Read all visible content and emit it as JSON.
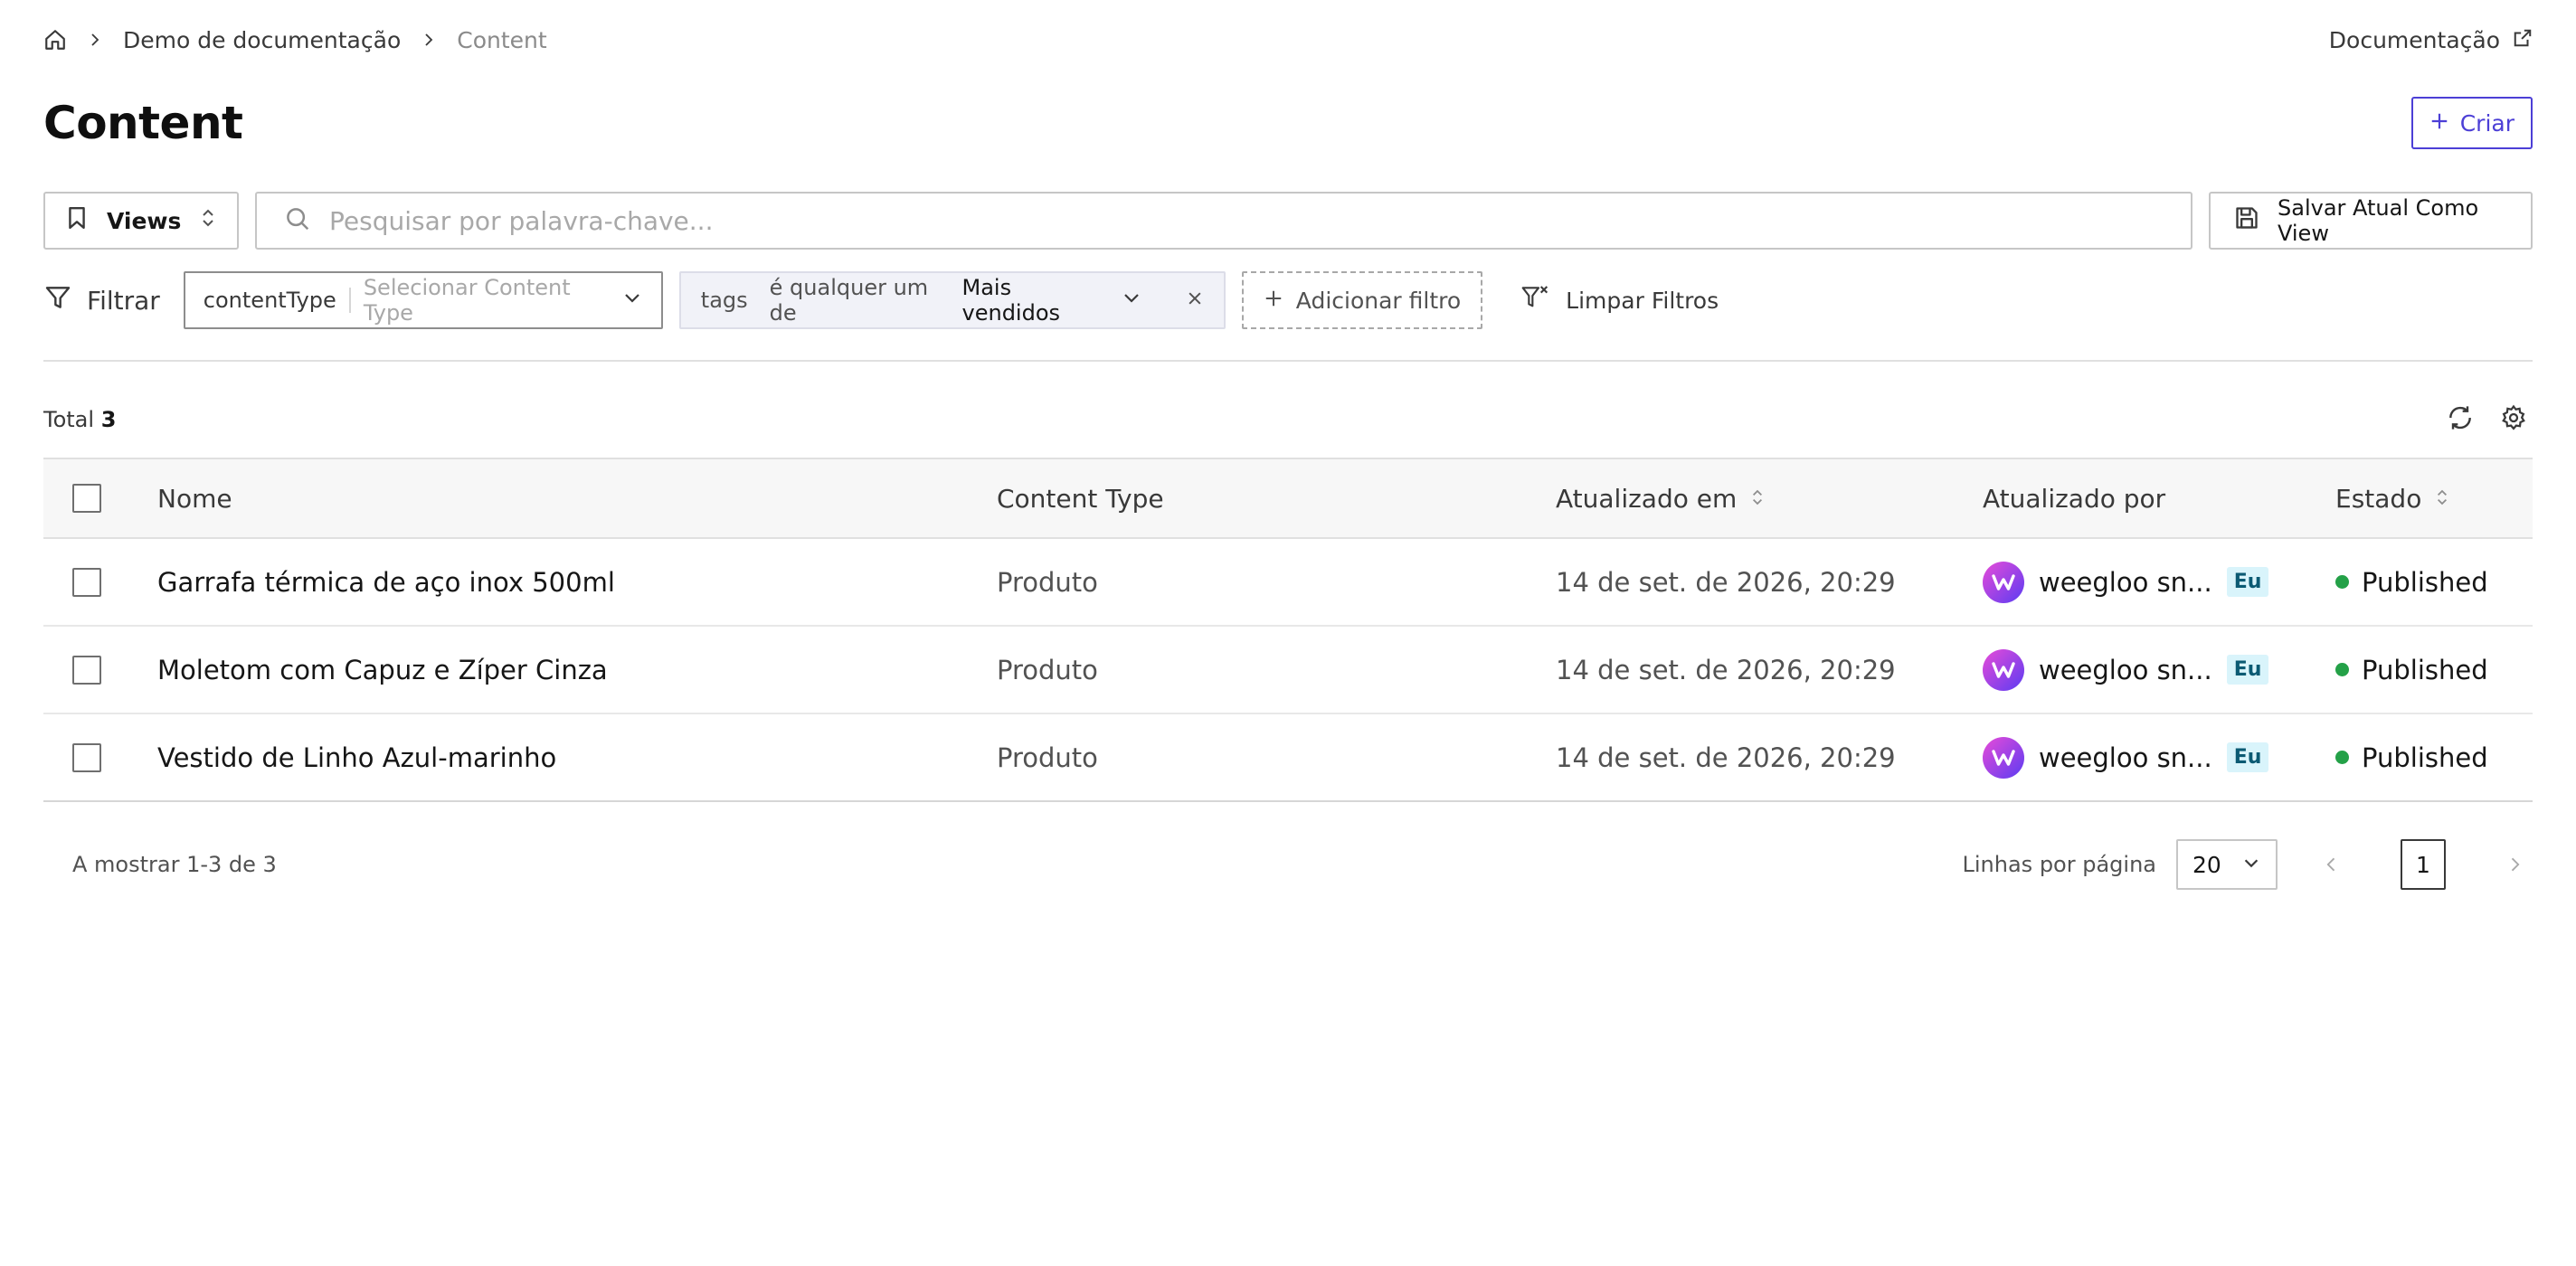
{
  "breadcrumb": {
    "items": [
      "Demo de documentação",
      "Content"
    ]
  },
  "top_links": {
    "documentation": "Documentação"
  },
  "header": {
    "title": "Content",
    "create_label": "Criar"
  },
  "toolbar": {
    "views_label": "Views",
    "search_placeholder": "Pesquisar por palavra-chave...",
    "save_view_label": "Salvar Atual Como View"
  },
  "filters": {
    "label": "Filtrar",
    "content_type": {
      "key": "contentType",
      "placeholder": "Selecionar Content Type"
    },
    "tags": {
      "key": "tags",
      "operator": "é qualquer um de",
      "value": "Mais vendidos"
    },
    "add_filter_label": "Adicionar filtro",
    "clear_label": "Limpar Filtros"
  },
  "summary": {
    "total_label": "Total",
    "total_count": "3"
  },
  "table": {
    "columns": {
      "name": "Nome",
      "content_type": "Content Type",
      "updated_at": "Atualizado em",
      "updated_by": "Atualizado por",
      "state": "Estado"
    },
    "rows": [
      {
        "name": "Garrafa térmica de aço inox 500ml",
        "content_type": "Produto",
        "updated_at": "14 de set. de 2026, 20:29",
        "updated_by": "weegloo sn...",
        "badge": "Eu",
        "state": "Published"
      },
      {
        "name": "Moletom com Capuz e Zíper Cinza",
        "content_type": "Produto",
        "updated_at": "14 de set. de 2026, 20:29",
        "updated_by": "weegloo sn...",
        "badge": "Eu",
        "state": "Published"
      },
      {
        "name": "Vestido de Linho Azul-marinho",
        "content_type": "Produto",
        "updated_at": "14 de set. de 2026, 20:29",
        "updated_by": "weegloo sn...",
        "badge": "Eu",
        "state": "Published"
      }
    ]
  },
  "pagination": {
    "showing": "A mostrar 1-3 de 3",
    "rows_per_page_label": "Linhas por página",
    "rows_per_page_value": "20",
    "current_page": "1"
  },
  "colors": {
    "accent": "#4c3fd6",
    "published": "#24a148",
    "badge_bg": "#d9f4fb"
  }
}
